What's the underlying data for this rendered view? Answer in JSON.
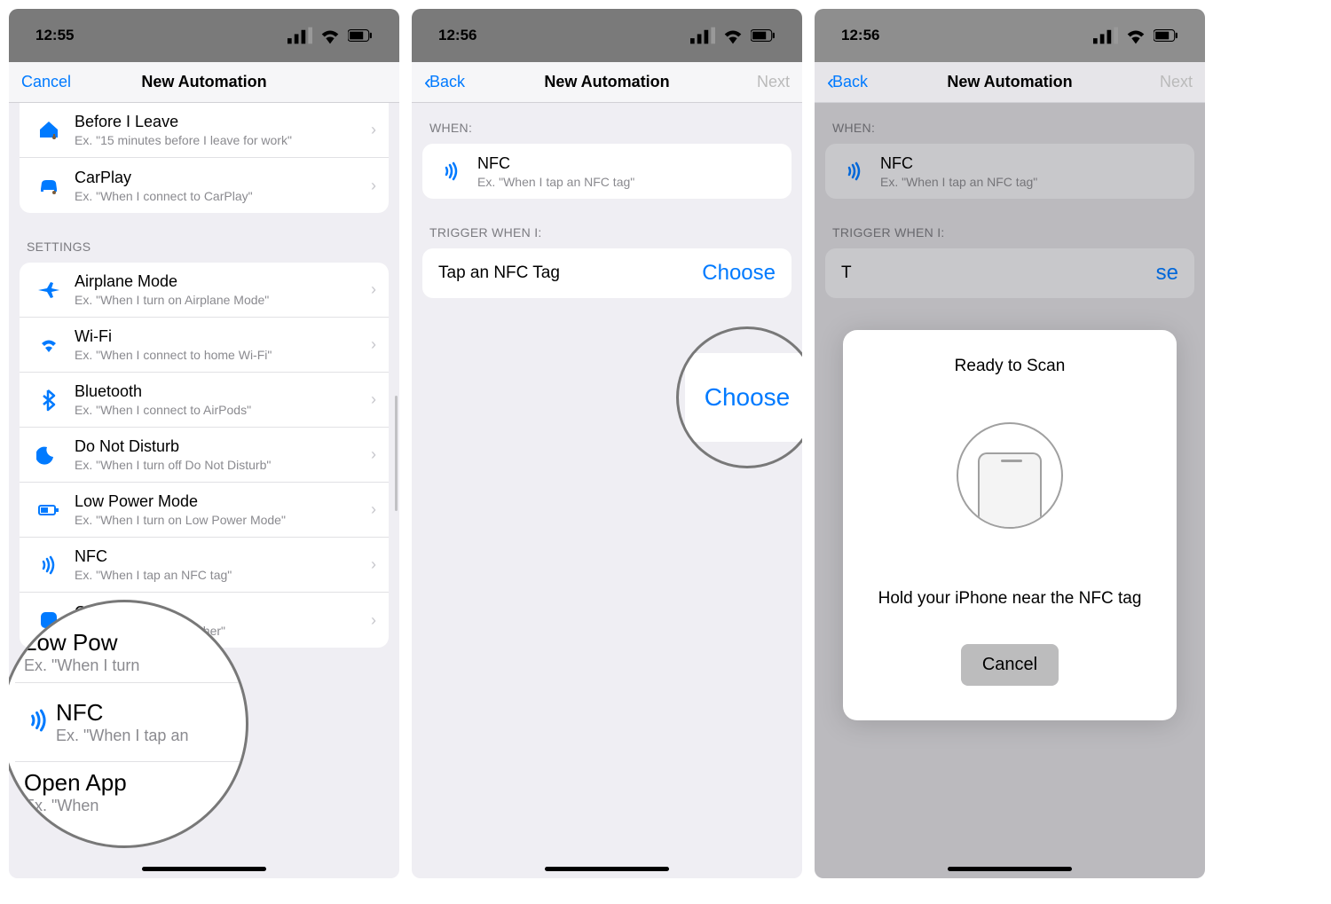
{
  "colors": {
    "accent": "#007aff",
    "navBg": "#f6f6f8",
    "panelBg": "#efeef3"
  },
  "screen1": {
    "statusTime": "12:55",
    "navLeft": "Cancel",
    "navTitle": "New Automation",
    "groupTop": [
      {
        "icon": "home-leave-icon",
        "title": "Before I Leave",
        "sub": "Ex. \"15 minutes before I leave for work\""
      },
      {
        "icon": "car-icon",
        "title": "CarPlay",
        "sub": "Ex. \"When I connect to CarPlay\""
      }
    ],
    "sectionSettings": "SETTINGS",
    "settings": [
      {
        "icon": "airplane-icon",
        "title": "Airplane Mode",
        "sub": "Ex. \"When I turn on Airplane Mode\""
      },
      {
        "icon": "wifi-icon",
        "title": "Wi-Fi",
        "sub": "Ex. \"When I connect to home Wi-Fi\""
      },
      {
        "icon": "bluetooth-icon",
        "title": "Bluetooth",
        "sub": "Ex. \"When I connect to AirPods\""
      },
      {
        "icon": "dnd-icon",
        "title": "Do Not Disturb",
        "sub": "Ex. \"When I turn off Do Not Disturb\""
      },
      {
        "icon": "battery-icon",
        "title": "Low Power Mode",
        "sub": "Ex. \"When I turn on Low Power Mode\""
      },
      {
        "icon": "nfc-icon",
        "title": "NFC",
        "sub": "Ex. \"When I tap an NFC tag\""
      },
      {
        "icon": "app-icon",
        "title": "Open App",
        "sub": "Ex. \"When I open Weather\""
      }
    ],
    "mag": {
      "lowTitle": "Low Pow",
      "lowSub": "Ex. \"When I turn",
      "nfcTitle": "NFC",
      "nfcSub": "Ex. \"When I tap an",
      "openTitle": "Open App",
      "openSub": "Ex. \"When"
    }
  },
  "screen2": {
    "statusTime": "12:56",
    "navBack": "Back",
    "navTitle": "New Automation",
    "navNext": "Next",
    "whenHeader": "WHEN:",
    "nfcTitle": "NFC",
    "nfcSub": "Ex. \"When I tap an NFC tag\"",
    "triggerHeader": "TRIGGER WHEN I:",
    "tapLabel": "Tap an NFC Tag",
    "choose": "Choose"
  },
  "screen3": {
    "statusTime": "12:56",
    "navBack": "Back",
    "navTitle": "New Automation",
    "navNext": "Next",
    "whenHeader": "WHEN:",
    "nfcTitle": "NFC",
    "nfcSub": "Ex. \"When I tap an NFC tag\"",
    "triggerHeader": "TRIGGER WHEN I:",
    "tapLabel": "T",
    "chooseTrail": "se",
    "scanTitle": "Ready to Scan",
    "scanMsg": "Hold your iPhone near the NFC tag",
    "scanCancel": "Cancel"
  }
}
